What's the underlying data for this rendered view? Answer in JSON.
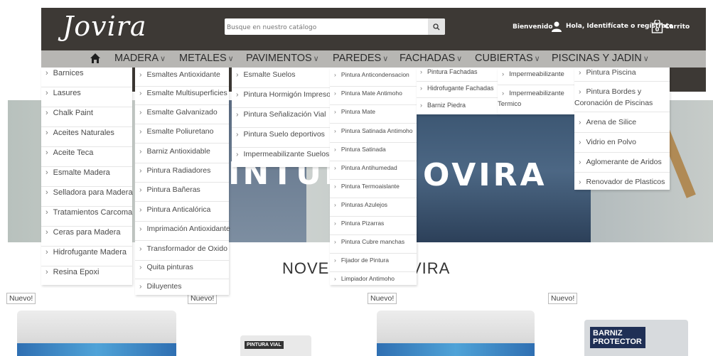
{
  "header": {
    "logo": "Jovira",
    "search_placeholder": "Busque en nuestro catálogo",
    "welcome": "Bienvenido",
    "login": "Hola, Identifícate o regístrate",
    "cart_count": "0",
    "cart_label": "Carrito"
  },
  "nav": {
    "items": [
      "MADERA",
      "METALES",
      "PAVIMENTOS",
      "PAREDES",
      "FACHADAS",
      "CUBIERTAS",
      "PISCINAS Y JADIN"
    ]
  },
  "menus": {
    "madera": [
      "Barnices",
      "Lasures",
      "Chalk Paint",
      "Aceites Naturales",
      "Aceite Teca",
      "Esmalte Madera",
      "Selladora para Madera",
      "Tratamientos Carcoma",
      "Ceras para Madera",
      "Hidrofugante Madera",
      "Resina Epoxi"
    ],
    "metales": [
      "Esmaltes Antioxidante",
      "Esmalte Multisuperficies",
      "Esmalte Galvanizado",
      "Esmalte Poliuretano",
      "Barniz Antioxidable",
      "Pintura Radiadores",
      "Pintura Bañeras",
      "Pintura Anticalórica",
      "Imprimación Antioxidante",
      "Transformador de Oxido",
      "Quita pinturas",
      "Diluyentes"
    ],
    "pavimentos": [
      "Esmalte Suelos",
      "Pintura Hormigón Impreso",
      "Pintura Señalización Vial",
      "Pintura Suelo deportivos",
      "Impermeabilizante Suelos"
    ],
    "paredes": [
      "Pintura Anticondensacion",
      "Pintura Mate Antimoho",
      "Pintura Mate",
      "Pintura Satinada Antimoho",
      "Pintura Satinada",
      "Pintura Antihumedad",
      "Pintura Termoaislante",
      "Pinturas Azulejos",
      "Pintura Pizarras",
      "Pintura Cubre manchas",
      "Fijador de Pintura",
      "Limpiador Antimoho"
    ],
    "fachadas": [
      "Pintura Fachadas",
      "Hidrofugante Fachadas",
      "Barniz Piedra"
    ],
    "cubiertas": [
      "Impermeabilizante",
      "Impermeabilizante",
      "Termico"
    ],
    "piscinas": [
      "Pintura Piscina",
      "Pintura Bordes y",
      "Coronación de Piscinas",
      "Arena de Silice",
      "Vidrio en Polvo",
      "Aglomerante de Aridos",
      "Renovador de Plasticos"
    ]
  },
  "banner": {
    "text_left": "INTUR",
    "text_right": "OVIRA"
  },
  "section": {
    "title_left": "NOVE",
    "title_right": "VIRA"
  },
  "products": {
    "badge": "Nuevo!",
    "can_label": "PINTURA VIAL",
    "varnish_label": "BARNIZ PROTECTOR"
  },
  "colors": {
    "header_bg": "#3d3935",
    "nav_bg": "#b7b6b3"
  }
}
